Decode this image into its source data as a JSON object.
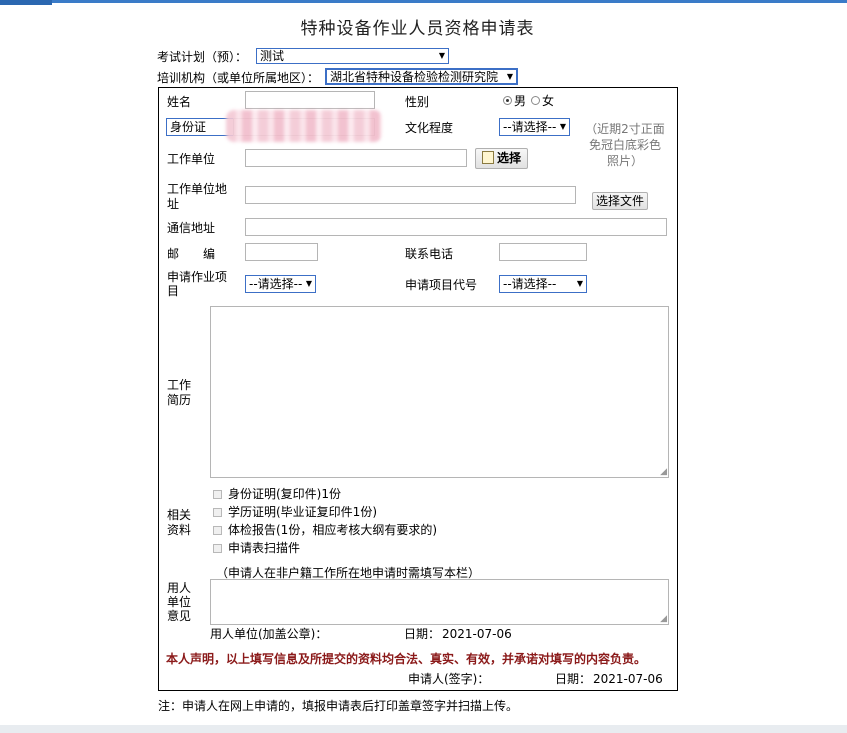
{
  "title": "特种设备作业人员资格申请表",
  "exam_plan": {
    "label": "考试计划（预）：",
    "value": "测试"
  },
  "training_org": {
    "label": "培训机构（或单位所属地区）：",
    "value": "湖北省特种设备检验检测研究院"
  },
  "form": {
    "name_label": "姓名",
    "name_value": "",
    "gender_label": "性别",
    "gender_options": [
      "男",
      "女"
    ],
    "gender_selected": "男",
    "id_type": "身份证",
    "id_number": "",
    "education_label": "文化程度",
    "education_value": "--请选择--",
    "photo_hint_lines": [
      "（近期2寸正面",
      "免冠白底彩色",
      "照片）"
    ],
    "work_unit_label": "工作单位",
    "select_label": "选择",
    "work_address_label_lines": [
      "工作单位地",
      "址"
    ],
    "choose_file_label": "选择文件",
    "mail_address_label": "通信地址",
    "postcode_label_chars": [
      "邮",
      "编"
    ],
    "phone_label": "联系电话",
    "apply_item_label_lines": [
      "申请作业项",
      "目"
    ],
    "apply_item_value": "--请选择--",
    "apply_code_label": "申请项目代号",
    "apply_code_value": "--请选择--",
    "resume_label_lines": [
      "工作",
      "简历"
    ],
    "docs_label_lines": [
      "相关",
      "资料"
    ],
    "docs": [
      "身份证明(复印件)1份",
      "学历证明(毕业证复印件1份)",
      "体检报告(1份，相应考核大纲有要求的)",
      "申请表扫描件"
    ],
    "employer_label_lines": [
      "用人",
      "单位",
      "意见"
    ],
    "employer_note": "（申请人在非户籍工作所在地申请时需填写本栏）",
    "employer_unit_label": "用人单位(加盖公章)：",
    "date_label": "日期：",
    "date_value": "2021-07-06",
    "declaration": "本人声明，以上填写信息及所提交的资料均合法、真实、有效，并承诺对填写的内容负责。",
    "applicant_sign_label": "申请人(签字)：",
    "date2_label": "日期：",
    "date2_value": "2021-07-06"
  },
  "footnote": "注：申请人在网上申请的，填报申请表后打印盖章签字并扫描上传。",
  "colors": {
    "select_border": "#3c6fc6",
    "topbar": "#3a7bc8"
  }
}
